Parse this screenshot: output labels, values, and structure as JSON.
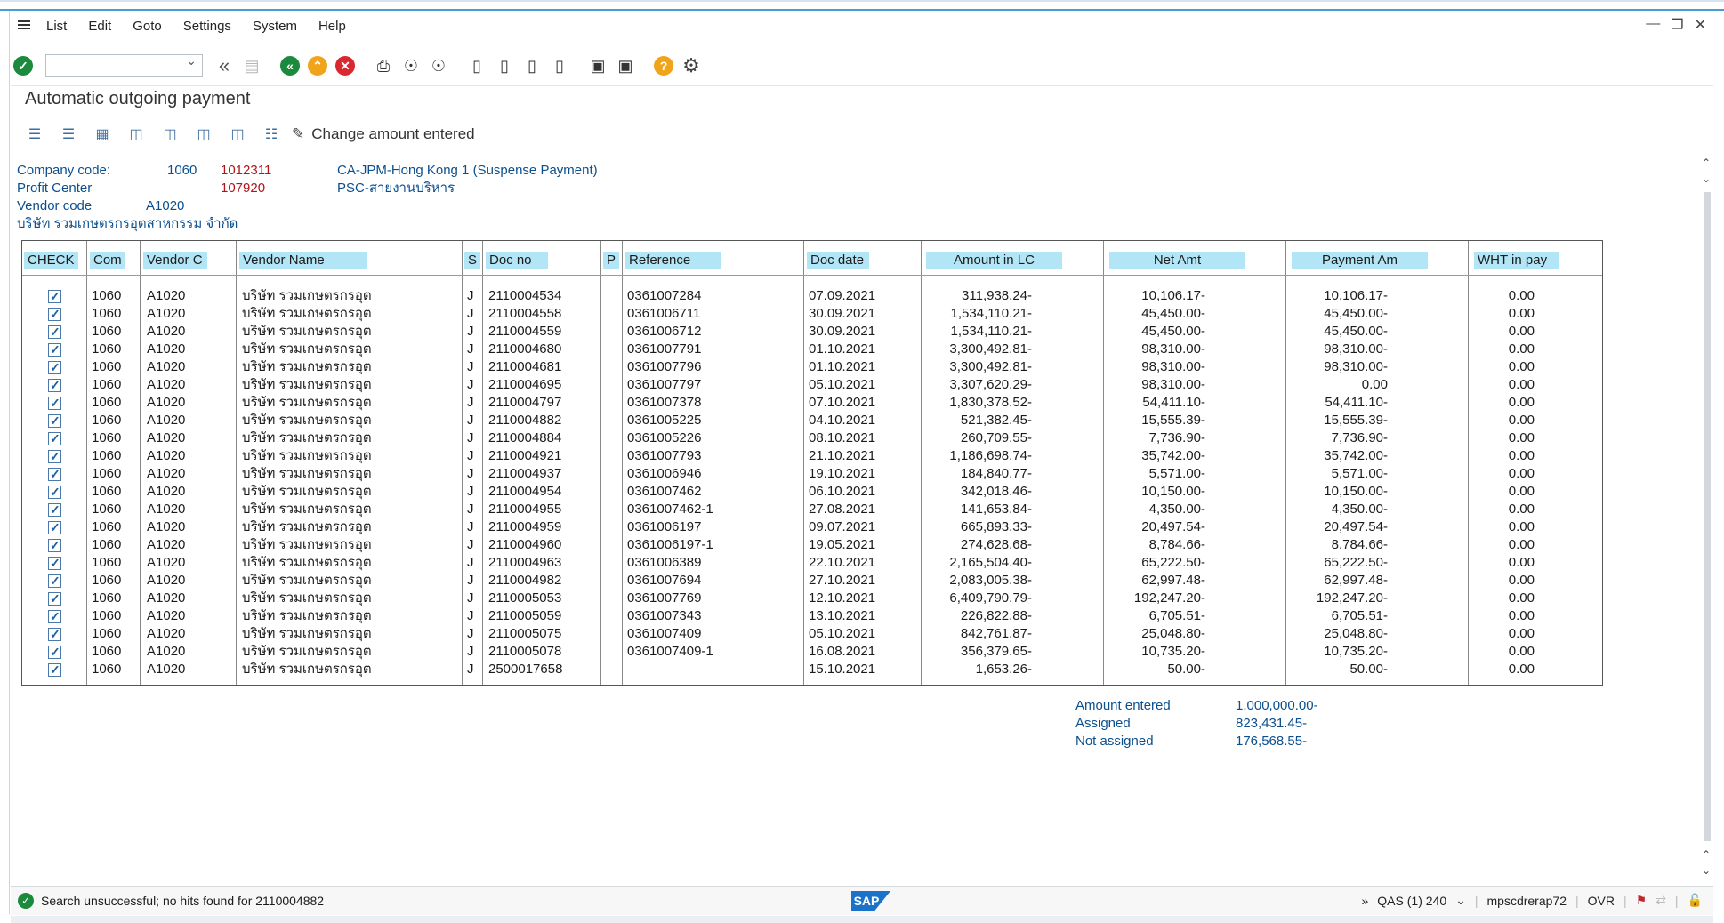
{
  "menu": {
    "items": [
      "List",
      "Edit",
      "Goto",
      "Settings",
      "System",
      "Help"
    ]
  },
  "page_title": "Automatic outgoing payment",
  "app_toolbar": {
    "change_amount_label": "Change amount entered"
  },
  "header": {
    "company_code_label": "Company code:",
    "company_code": "1060",
    "company_account": "1012311",
    "company_desc": "CA-JPM-Hong Kong 1 (Suspense Payment)",
    "profit_center_label": "Profit Center",
    "profit_center": "107920",
    "profit_center_desc": "PSC-สายงานบริหาร",
    "vendor_code_label": "Vendor code",
    "vendor_code": "A1020",
    "vendor_full_name": "บริษัท รวมเกษตรกรอุตสาหกรรม จำกัด"
  },
  "table": {
    "columns": [
      "CHECK",
      "Com",
      "Vendor C",
      "Vendor Name",
      "S",
      "Doc no",
      "P",
      "Reference",
      "Doc date",
      "Amount in LC",
      "Net Amt",
      "Payment Am",
      "WHT in pay"
    ],
    "rows": [
      {
        "com": "1060",
        "vendor": "A1020",
        "name": "บริษัท รวมเกษตรกรอุต",
        "s": "J",
        "doc": "2110004534",
        "ref": "0361007284",
        "date": "07.09.2021",
        "amount": "311,938.24-",
        "net": "10,106.17-",
        "payment": "10,106.17-",
        "wht": "0.00"
      },
      {
        "com": "1060",
        "vendor": "A1020",
        "name": "บริษัท รวมเกษตรกรอุต",
        "s": "J",
        "doc": "2110004558",
        "ref": "0361006711",
        "date": "30.09.2021",
        "amount": "1,534,110.21-",
        "net": "45,450.00-",
        "payment": "45,450.00-",
        "wht": "0.00"
      },
      {
        "com": "1060",
        "vendor": "A1020",
        "name": "บริษัท รวมเกษตรกรอุต",
        "s": "J",
        "doc": "2110004559",
        "ref": "0361006712",
        "date": "30.09.2021",
        "amount": "1,534,110.21-",
        "net": "45,450.00-",
        "payment": "45,450.00-",
        "wht": "0.00"
      },
      {
        "com": "1060",
        "vendor": "A1020",
        "name": "บริษัท รวมเกษตรกรอุต",
        "s": "J",
        "doc": "2110004680",
        "ref": "0361007791",
        "date": "01.10.2021",
        "amount": "3,300,492.81-",
        "net": "98,310.00-",
        "payment": "98,310.00-",
        "wht": "0.00"
      },
      {
        "com": "1060",
        "vendor": "A1020",
        "name": "บริษัท รวมเกษตรกรอุต",
        "s": "J",
        "doc": "2110004681",
        "ref": "0361007796",
        "date": "01.10.2021",
        "amount": "3,300,492.81-",
        "net": "98,310.00-",
        "payment": "98,310.00-",
        "wht": "0.00"
      },
      {
        "com": "1060",
        "vendor": "A1020",
        "name": "บริษัท รวมเกษตรกรอุต",
        "s": "J",
        "doc": "2110004695",
        "ref": "0361007797",
        "date": "05.10.2021",
        "amount": "3,307,620.29-",
        "net": "98,310.00-",
        "payment": "0.00",
        "wht": "0.00"
      },
      {
        "com": "1060",
        "vendor": "A1020",
        "name": "บริษัท รวมเกษตรกรอุต",
        "s": "J",
        "doc": "2110004797",
        "ref": "0361007378",
        "date": "07.10.2021",
        "amount": "1,830,378.52-",
        "net": "54,411.10-",
        "payment": "54,411.10-",
        "wht": "0.00"
      },
      {
        "com": "1060",
        "vendor": "A1020",
        "name": "บริษัท รวมเกษตรกรอุต",
        "s": "J",
        "doc": "2110004882",
        "ref": "0361005225",
        "date": "04.10.2021",
        "amount": "521,382.45-",
        "net": "15,555.39-",
        "payment": "15,555.39-",
        "wht": "0.00"
      },
      {
        "com": "1060",
        "vendor": "A1020",
        "name": "บริษัท รวมเกษตรกรอุต",
        "s": "J",
        "doc": "2110004884",
        "ref": "0361005226",
        "date": "08.10.2021",
        "amount": "260,709.55-",
        "net": "7,736.90-",
        "payment": "7,736.90-",
        "wht": "0.00"
      },
      {
        "com": "1060",
        "vendor": "A1020",
        "name": "บริษัท รวมเกษตรกรอุต",
        "s": "J",
        "doc": "2110004921",
        "ref": "0361007793",
        "date": "21.10.2021",
        "amount": "1,186,698.74-",
        "net": "35,742.00-",
        "payment": "35,742.00-",
        "wht": "0.00"
      },
      {
        "com": "1060",
        "vendor": "A1020",
        "name": "บริษัท รวมเกษตรกรอุต",
        "s": "J",
        "doc": "2110004937",
        "ref": "0361006946",
        "date": "19.10.2021",
        "amount": "184,840.77-",
        "net": "5,571.00-",
        "payment": "5,571.00-",
        "wht": "0.00"
      },
      {
        "com": "1060",
        "vendor": "A1020",
        "name": "บริษัท รวมเกษตรกรอุต",
        "s": "J",
        "doc": "2110004954",
        "ref": "0361007462",
        "date": "06.10.2021",
        "amount": "342,018.46-",
        "net": "10,150.00-",
        "payment": "10,150.00-",
        "wht": "0.00"
      },
      {
        "com": "1060",
        "vendor": "A1020",
        "name": "บริษัท รวมเกษตรกรอุต",
        "s": "J",
        "doc": "2110004955",
        "ref": "0361007462-1",
        "date": "27.08.2021",
        "amount": "141,653.84-",
        "net": "4,350.00-",
        "payment": "4,350.00-",
        "wht": "0.00"
      },
      {
        "com": "1060",
        "vendor": "A1020",
        "name": "บริษัท รวมเกษตรกรอุต",
        "s": "J",
        "doc": "2110004959",
        "ref": "0361006197",
        "date": "09.07.2021",
        "amount": "665,893.33-",
        "net": "20,497.54-",
        "payment": "20,497.54-",
        "wht": "0.00"
      },
      {
        "com": "1060",
        "vendor": "A1020",
        "name": "บริษัท รวมเกษตรกรอุต",
        "s": "J",
        "doc": "2110004960",
        "ref": "0361006197-1",
        "date": "19.05.2021",
        "amount": "274,628.68-",
        "net": "8,784.66-",
        "payment": "8,784.66-",
        "wht": "0.00"
      },
      {
        "com": "1060",
        "vendor": "A1020",
        "name": "บริษัท รวมเกษตรกรอุต",
        "s": "J",
        "doc": "2110004963",
        "ref": "0361006389",
        "date": "22.10.2021",
        "amount": "2,165,504.40-",
        "net": "65,222.50-",
        "payment": "65,222.50-",
        "wht": "0.00"
      },
      {
        "com": "1060",
        "vendor": "A1020",
        "name": "บริษัท รวมเกษตรกรอุต",
        "s": "J",
        "doc": "2110004982",
        "ref": "0361007694",
        "date": "27.10.2021",
        "amount": "2,083,005.38-",
        "net": "62,997.48-",
        "payment": "62,997.48-",
        "wht": "0.00"
      },
      {
        "com": "1060",
        "vendor": "A1020",
        "name": "บริษัท รวมเกษตรกรอุต",
        "s": "J",
        "doc": "2110005053",
        "ref": "0361007769",
        "date": "12.10.2021",
        "amount": "6,409,790.79-",
        "net": "192,247.20-",
        "payment": "192,247.20-",
        "wht": "0.00"
      },
      {
        "com": "1060",
        "vendor": "A1020",
        "name": "บริษัท รวมเกษตรกรอุต",
        "s": "J",
        "doc": "2110005059",
        "ref": "0361007343",
        "date": "13.10.2021",
        "amount": "226,822.88-",
        "net": "6,705.51-",
        "payment": "6,705.51-",
        "wht": "0.00"
      },
      {
        "com": "1060",
        "vendor": "A1020",
        "name": "บริษัท รวมเกษตรกรอุต",
        "s": "J",
        "doc": "2110005075",
        "ref": "0361007409",
        "date": "05.10.2021",
        "amount": "842,761.87-",
        "net": "25,048.80-",
        "payment": "25,048.80-",
        "wht": "0.00"
      },
      {
        "com": "1060",
        "vendor": "A1020",
        "name": "บริษัท รวมเกษตรกรอุต",
        "s": "J",
        "doc": "2110005078",
        "ref": "0361007409-1",
        "date": "16.08.2021",
        "amount": "356,379.65-",
        "net": "10,735.20-",
        "payment": "10,735.20-",
        "wht": "0.00"
      },
      {
        "com": "1060",
        "vendor": "A1020",
        "name": "บริษัท รวมเกษตรกรอุต",
        "s": "J",
        "doc": "2500017658",
        "ref": "",
        "date": "15.10.2021",
        "amount": "1,653.26-",
        "net": "50.00-",
        "payment": "50.00-",
        "wht": "0.00"
      }
    ]
  },
  "totals": {
    "amount_entered_label": "Amount entered",
    "amount_entered": "1,000,000.00-",
    "assigned_label": "Assigned",
    "assigned": "823,431.45-",
    "not_assigned_label": "Not assigned",
    "not_assigned": "176,568.55-"
  },
  "status": {
    "message": "Search unsuccessful; no hits found for 2110004882",
    "logo": "SAP",
    "system": "QAS (1) 240",
    "host": "mpscdrerap72",
    "mode": "OVR"
  },
  "colors": {
    "accent": "#4a9cd6",
    "header_bg": "#b2e6f7",
    "label_blue": "#0b4f8f",
    "value_red": "#b0151a",
    "ok_green": "#1b8a3c"
  },
  "icons": [
    "menu-icon",
    "enter-icon",
    "back-icon",
    "save-icon",
    "back-green-icon",
    "exit-icon",
    "cancel-icon",
    "print-icon",
    "find-icon",
    "find-next-icon",
    "first-page-icon",
    "prev-page-icon",
    "next-page-icon",
    "last-page-icon",
    "new-session-icon",
    "shortcut-icon",
    "help-icon",
    "settings-icon"
  ]
}
